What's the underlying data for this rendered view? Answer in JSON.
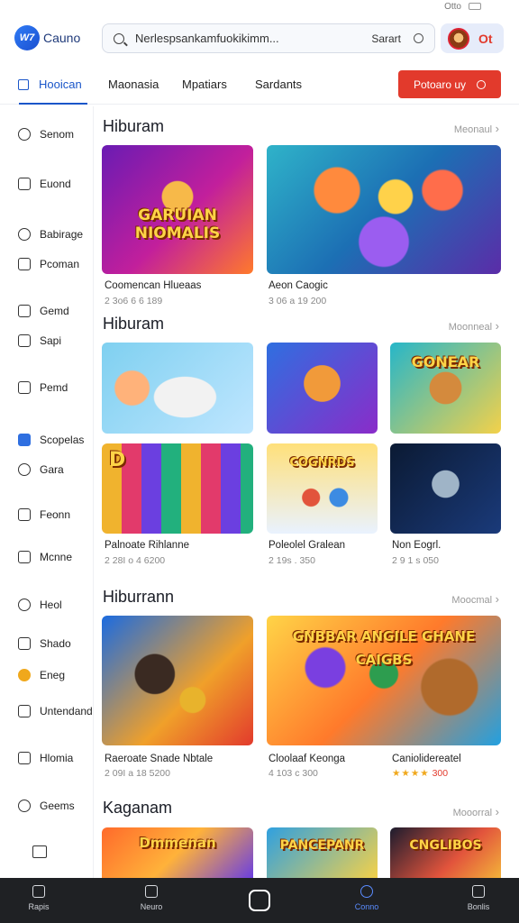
{
  "status": {
    "right_text": "Otto"
  },
  "header": {
    "logo_text": "W7",
    "brand": "Cauno",
    "search_placeholder": "Nerlespsankamfuokikimm...",
    "search_button": "Sarart",
    "user_badge": "Ot"
  },
  "tabs": {
    "items": [
      "Hooican",
      "Maonasia",
      "Mpatiars",
      "Sardants"
    ],
    "active": "Hooican",
    "cta_label": "Potoaro uy"
  },
  "sidebar": {
    "items": [
      "Senom",
      "Euond",
      "Babirage",
      "Pcoman",
      "Gemd",
      "Sapi",
      "Pemd",
      "Scopelas",
      "Gara",
      "Feonn",
      "Mcnne",
      "Heol",
      "Shado",
      "Eneg",
      "Untendand",
      "Hlomia",
      "Geems"
    ]
  },
  "sections": [
    {
      "title": "Hiburam",
      "more": "Meonaul",
      "cards": [
        {
          "art_title": "GARUIAN NIOMALIS",
          "title": "Coomencan Hlueaas",
          "sub": "2 3o6 6 6 189"
        },
        {
          "art_title": "",
          "title": "Aeon Caogic",
          "sub": "3 06 a 19 200"
        }
      ]
    },
    {
      "title": "Hiburam",
      "more": "Moonneal",
      "cards": [
        {
          "art_title": "",
          "title": "",
          "sub": ""
        },
        {
          "art_title": "",
          "title": "",
          "sub": ""
        },
        {
          "art_title": "GONEAR",
          "title": "",
          "sub": ""
        },
        {
          "art_title": "D",
          "title": "Palnoate Rihlanne",
          "sub": "2 28I o 4 6200"
        },
        {
          "art_title": "COGNRDS",
          "title": "Poleolel Gralean",
          "sub": "2 19s . 350"
        },
        {
          "art_title": "",
          "title": "Non Eogrl.",
          "sub": "2 9 1 s 050"
        }
      ]
    },
    {
      "title": "Hiburrann",
      "more": "Moocmal",
      "cards": [
        {
          "art_title": "",
          "title": "Raeroate Snade Nbtale",
          "sub": "2 09I a 18 5200"
        },
        {
          "art_title": "GNBBAR ANGILE GHANE CAIGBS",
          "title": "Cloolaaf Keonga",
          "sub": "4 103 c 300"
        },
        {
          "art_title": "",
          "title": "Caniolidereatel",
          "stars": "★★★★",
          "rating": "300"
        }
      ]
    },
    {
      "title": "Kaganam",
      "more": "Mooorral",
      "cards": [
        {
          "art_title": "Dmmenan",
          "title": "",
          "sub": ""
        },
        {
          "art_title": "PANCEPANR",
          "title": "",
          "sub": ""
        },
        {
          "art_title": "CNGLIBOS",
          "title": "",
          "sub": ""
        }
      ]
    }
  ],
  "bottomnav": {
    "items": [
      "Rapis",
      "Neuro",
      "",
      "Conno",
      "Bonlis"
    ],
    "active": "Conno"
  },
  "colors": {
    "accent": "#1a56c9",
    "cta": "#e23a2c",
    "nav_bg": "#1f2124"
  }
}
